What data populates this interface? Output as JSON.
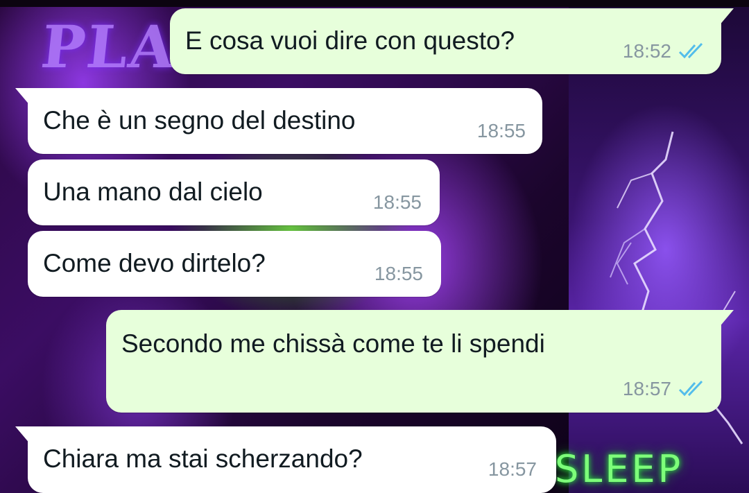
{
  "wallpaper": {
    "neon_left": "PLAY",
    "neon_bottom_right": "SLEEP",
    "accent_purple": "#8a3cff",
    "accent_green": "#7dff7a"
  },
  "colors": {
    "incoming_bubble": "#ffffff",
    "outgoing_bubble": "#e7ffdb",
    "timestamp": "#8696a0",
    "read_ticks": "#53bdeb"
  },
  "messages": [
    {
      "direction": "outgoing",
      "text": "E cosa vuoi dire con questo?",
      "time": "18:52",
      "status": "read-double-check-icon"
    },
    {
      "direction": "incoming",
      "text": "Che è un segno del destino",
      "time": "18:55"
    },
    {
      "direction": "incoming",
      "text": "Una mano dal cielo",
      "time": "18:55"
    },
    {
      "direction": "incoming",
      "text": "Come devo dirtelo?",
      "time": "18:55"
    },
    {
      "direction": "outgoing",
      "text": "Secondo me chissà come te li spendi",
      "time": "18:57",
      "status": "read-double-check-icon"
    },
    {
      "direction": "incoming",
      "text": "Chiara ma stai scherzando?",
      "time": "18:57"
    }
  ]
}
